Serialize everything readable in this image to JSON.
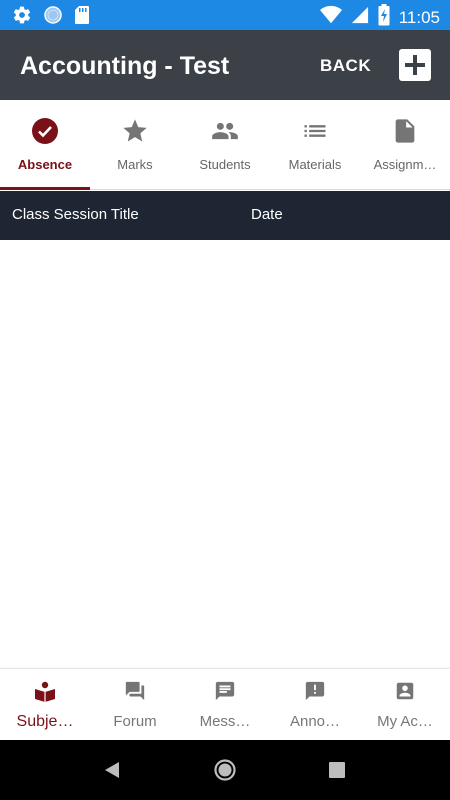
{
  "status_bar": {
    "time": "11:05",
    "icons": [
      "settings-icon",
      "globe-icon",
      "sd-card-icon",
      "wifi-icon",
      "signal-icon",
      "battery-charging-icon"
    ]
  },
  "app_bar": {
    "title": "Accounting - Test",
    "back_label": "BACK",
    "add_icon": "plus-icon"
  },
  "tabs": [
    {
      "label": "Absence",
      "icon": "check-circle-icon",
      "active": true
    },
    {
      "label": "Marks",
      "icon": "star-icon",
      "active": false
    },
    {
      "label": "Students",
      "icon": "people-icon",
      "active": false
    },
    {
      "label": "Materials",
      "icon": "list-icon",
      "active": false
    },
    {
      "label": "Assignm…",
      "icon": "document-icon",
      "active": false
    }
  ],
  "table": {
    "columns": [
      "Class Session Title",
      "Date"
    ],
    "rows": []
  },
  "bottom_nav": [
    {
      "label": "Subje…",
      "icon": "book-reader-icon",
      "active": true
    },
    {
      "label": "Forum",
      "icon": "forum-icon",
      "active": false
    },
    {
      "label": "Mess…",
      "icon": "message-icon",
      "active": false
    },
    {
      "label": "Anno…",
      "icon": "announcement-icon",
      "active": false
    },
    {
      "label": "My Ac…",
      "icon": "account-box-icon",
      "active": false
    }
  ],
  "colors": {
    "status_bar": "#1e88e5",
    "app_bar": "#3c4148",
    "accent": "#7b1118",
    "table_header": "#1d2632",
    "inactive_icon": "#757575"
  }
}
